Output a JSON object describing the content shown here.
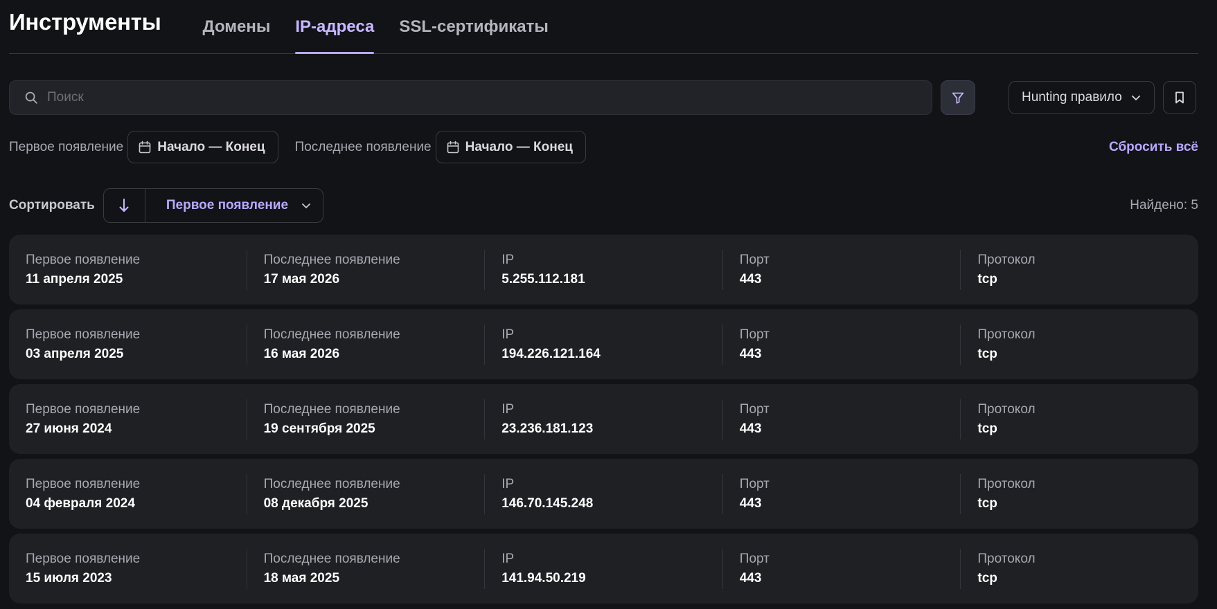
{
  "header": {
    "title": "Инструменты",
    "tabs": [
      {
        "label": "Домены",
        "active": false
      },
      {
        "label": "IP-адреса",
        "active": true
      },
      {
        "label": "SSL-сертификаты",
        "active": false
      }
    ]
  },
  "toolbar": {
    "search_placeholder": "Поиск",
    "search_value": "",
    "hunting_label": "Hunting правило"
  },
  "dates": {
    "first_label": "Первое появление",
    "first_range": "Начало — Конец",
    "last_label": "Последнее появление",
    "last_range": "Начало — Конец",
    "reset_label": "Сбросить всё"
  },
  "sort": {
    "label": "Сортировать",
    "field": "Первое появление",
    "found": "Найдено: 5"
  },
  "columns": [
    "Первое появление",
    "Последнее появление",
    "IP",
    "Порт",
    "Протокол"
  ],
  "rows": [
    [
      "11 апреля 2025",
      "17 мая 2026",
      "5.255.112.181",
      "443",
      "tcp"
    ],
    [
      "03 апреля 2025",
      "16 мая 2026",
      "194.226.121.164",
      "443",
      "tcp"
    ],
    [
      "27 июня 2024",
      "19 сентября 2025",
      "23.236.181.123",
      "443",
      "tcp"
    ],
    [
      "04 февраля 2024",
      "08 декабря 2025",
      "146.70.145.248",
      "443",
      "tcp"
    ],
    [
      "15 июля 2023",
      "18 мая 2025",
      "141.94.50.219",
      "443",
      "tcp"
    ]
  ],
  "colors": {
    "background": "#121316",
    "card": "#1f2024",
    "accent": "#b9a8ff",
    "text": "#ffffff",
    "muted": "#a8a9b0"
  },
  "icons": {
    "search": "search-icon",
    "filter": "filter-icon",
    "chevron": "chevron-down-icon",
    "bookmark": "bookmark-icon",
    "calendar": "calendar-icon",
    "sort_direction": "arrow-down-icon"
  }
}
